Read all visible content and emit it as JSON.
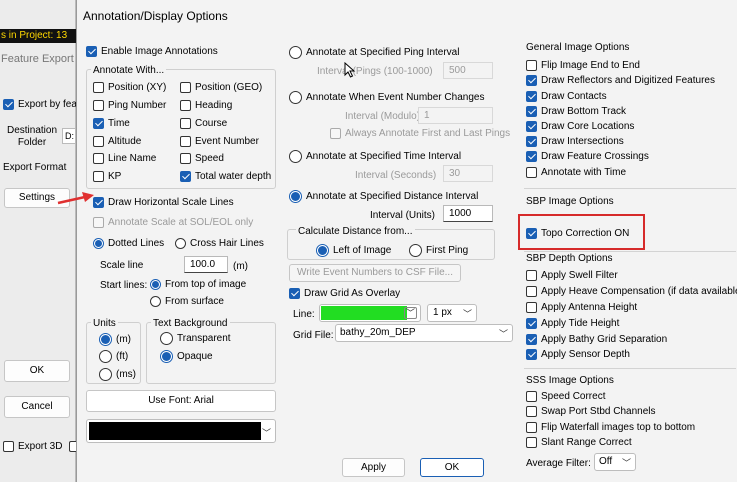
{
  "background": {
    "project_text": "s in Project: 13",
    "feature_export": "Feature Export",
    "export_by_fea": "Export by fea",
    "destination_line1": "Destination",
    "destination_line2": "Folder",
    "drive_stub": "D:",
    "export_format": "Export Format",
    "settings": "Settings",
    "ok": "OK",
    "cancel": "Cancel",
    "export_3d": "Export 3D"
  },
  "dialog": {
    "title": "Annotation/Display Options"
  },
  "left": {
    "enable_image_annotations": "Enable Image Annotations",
    "annotate_with": "Annotate With...",
    "position_xy": "Position (XY)",
    "position_geo": "Position (GEO)",
    "ping_number": "Ping Number",
    "heading": "Heading",
    "time": "Time",
    "course": "Course",
    "altitude": "Altitude",
    "event_number": "Event Number",
    "line_name": "Line Name",
    "speed": "Speed",
    "kp": "KP",
    "total_water_depth": "Total water depth",
    "draw_horizontal_scale_lines": "Draw Horizontal Scale Lines",
    "annotate_scale": "Annotate Scale at SOL/EOL only",
    "dotted_lines": "Dotted Lines",
    "cross_hair_lines": "Cross Hair Lines",
    "scale_line": "Scale line",
    "scale_value": "100.0",
    "scale_unit": "(m)",
    "start_lines": "Start lines:",
    "from_top_of_image": "From top of image",
    "from_surface": "From surface",
    "units": "Units",
    "unit_m": "(m)",
    "unit_ft": "(ft)",
    "unit_ms": "(ms)",
    "text_background": "Text Background",
    "transparent": "Transparent",
    "opaque": "Opaque",
    "use_font": "Use Font: Arial",
    "font_color": "#000000"
  },
  "middle": {
    "ping_interval": "Annotate at Specified Ping Interval",
    "interval_pings": "Interval (Pings (100-1000)",
    "interval_pings_value": "500",
    "event_number_changes": "Annotate When Event Number Changes",
    "interval_modulo": "Interval (Modulo)",
    "interval_modulo_value": "1",
    "always_annotate": "Always Annotate First and Last Pings",
    "time_interval": "Annotate at Specified Time Interval",
    "interval_seconds": "Interval (Seconds)",
    "interval_seconds_value": "30",
    "distance_interval": "Annotate at Specified Distance Interval",
    "interval_units": "Interval (Units)",
    "interval_units_value": "1000",
    "calc_distance": "Calculate Distance from...",
    "left_of_image": "Left of Image",
    "first_ping": "First Ping",
    "write_event_numbers": "Write Event Numbers to CSF File...",
    "draw_grid": "Draw Grid As Overlay",
    "line": "Line:",
    "line_color": "#22dd22",
    "line_width": "1 px",
    "grid_file": "Grid File:",
    "grid_file_value": "bathy_20m_DEP",
    "apply": "Apply",
    "ok": "OK"
  },
  "right": {
    "general_title": "General Image Options",
    "flip_image": "Flip Image End to End",
    "draw_reflectors": "Draw Reflectors and Digitized Features",
    "draw_contacts": "Draw Contacts",
    "draw_bottom_track": "Draw Bottom Track",
    "draw_core_locations": "Draw Core Locations",
    "draw_intersections": "Draw Intersections",
    "draw_feature_crossings": "Draw Feature Crossings",
    "annotate_with_time": "Annotate with Time",
    "sbp_image_title": "SBP Image Options",
    "topo_correction": "Topo Correction ON",
    "sbp_depth_title": "SBP Depth Options",
    "apply_swell": "Apply Swell Filter",
    "apply_heave": "Apply Heave Compensation (if data available)",
    "apply_antenna": "Apply Antenna Height",
    "apply_tide": "Apply Tide Height",
    "apply_bathy": "Apply Bathy Grid Separation",
    "apply_sensor": "Apply Sensor Depth",
    "sss_title": "SSS Image Options",
    "speed_correct": "Speed Correct",
    "swap_port": "Swap Port Stbd Channels",
    "flip_waterfall": "Flip Waterfall images top to bottom",
    "slant_range": "Slant Range Correct",
    "average_filter": "Average Filter:",
    "average_filter_value": "Off"
  },
  "colors": {
    "accent": "#1a5fb4",
    "highlight": "#d62a2a",
    "arrow": "#e03030"
  }
}
